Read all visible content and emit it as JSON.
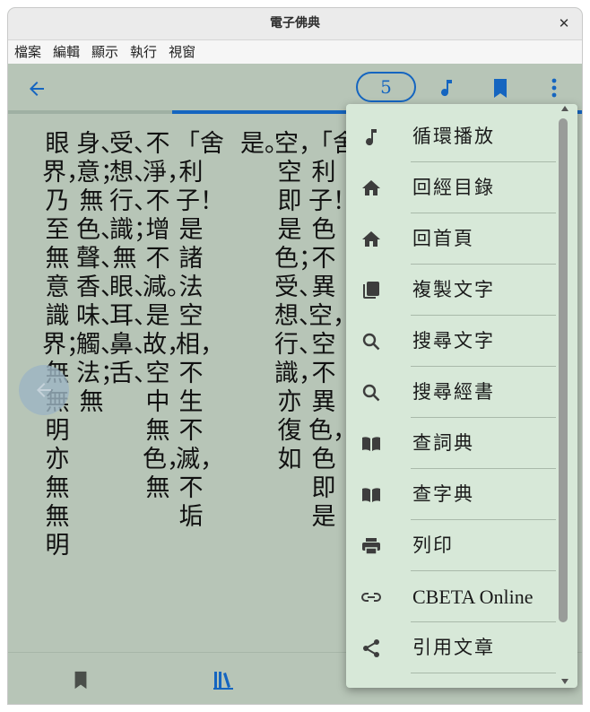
{
  "window": {
    "title": "電子佛典"
  },
  "menubar": {
    "items": [
      "檔案",
      "編輯",
      "顯示",
      "執行",
      "視窗"
    ]
  },
  "appbar": {
    "page_number": "5"
  },
  "reading": {
    "progress_percent": 28,
    "columns": [
      "「舍利子！色不異空，空不異色，色即是",
      "空，空即是色；受、想、行、識，亦復如",
      "是。",
      "「舍利子！是諸法空相，不生不滅，不垢",
      "不淨，不增不減。是故，空中無色，無",
      "受、想、行、識；無眼、耳、鼻、舌、",
      "身、意；無色、聲、香、味、觸、法；無",
      "眼界，乃至無意識界；無無明亦無無明"
    ]
  },
  "overflow_menu": {
    "items": [
      {
        "label": "循環播放",
        "icon": "music-note-icon"
      },
      {
        "label": "回經目錄",
        "icon": "home-icon"
      },
      {
        "label": "回首頁",
        "icon": "home-icon"
      },
      {
        "label": "複製文字",
        "icon": "copy-icon"
      },
      {
        "label": "搜尋文字",
        "icon": "search-icon"
      },
      {
        "label": "搜尋經書",
        "icon": "search-icon"
      },
      {
        "label": "查詞典",
        "icon": "book-open-icon"
      },
      {
        "label": "查字典",
        "icon": "book-open-icon"
      },
      {
        "label": "列印",
        "icon": "printer-icon"
      },
      {
        "label": "CBETA Online",
        "icon": "link-icon"
      },
      {
        "label": "引用文章",
        "icon": "share-icon"
      }
    ]
  },
  "colors": {
    "accent": "#1565c0",
    "background": "#b7c5b7",
    "menu_background": "#d7e8d8"
  }
}
